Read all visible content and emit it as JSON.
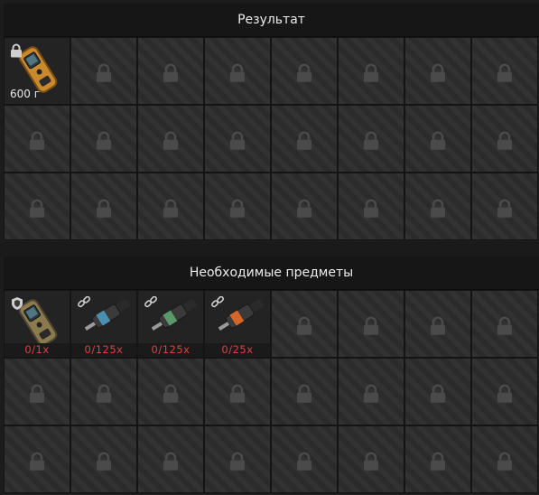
{
  "result": {
    "title": "Результат",
    "item": {
      "icon": "detector-device-icon",
      "weight": "600 г",
      "locked": true
    }
  },
  "required": {
    "title": "Необходимые предметы",
    "items": [
      {
        "icon": "detector-device-icon",
        "count": "0/1x",
        "accent": "#c9a24a",
        "linked": false
      },
      {
        "icon": "injector-blue-icon",
        "count": "0/125x",
        "accent": "#4a8fb0",
        "linked": true
      },
      {
        "icon": "injector-green-icon",
        "count": "0/125x",
        "accent": "#5a9a6a",
        "linked": true
      },
      {
        "icon": "injector-orange-icon",
        "count": "0/25x",
        "accent": "#d4662a",
        "linked": true
      }
    ]
  },
  "colors": {
    "count_text": "#e04040",
    "header_text": "#ececec"
  }
}
